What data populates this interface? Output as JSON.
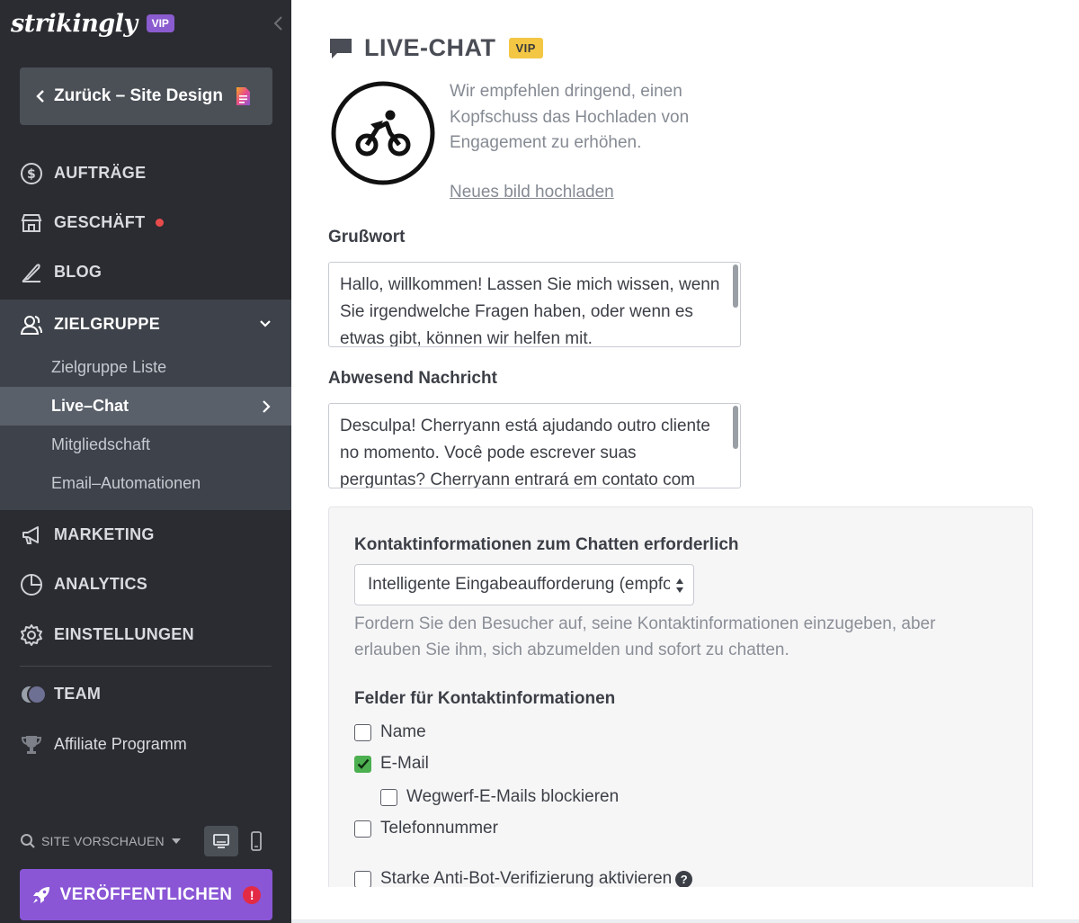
{
  "brand": {
    "logo_text": "strikingly",
    "vip_label": "VIP"
  },
  "sidebar": {
    "back_label": "Zurück – Site Design",
    "nav": [
      {
        "label": "AUFTRÄGE",
        "icon": "dollar-circle-icon"
      },
      {
        "label": "GESCHÄFT",
        "icon": "store-icon",
        "badge": "red-dot"
      },
      {
        "label": "BLOG",
        "icon": "feather-pen-icon"
      },
      {
        "label": "ZIELGRUPPE",
        "icon": "users-icon",
        "expanded": true
      }
    ],
    "audience_sub": [
      {
        "label": "Zielgruppe Liste"
      },
      {
        "label": "Live–Chat",
        "active": true
      },
      {
        "label": "Mitgliedschaft"
      },
      {
        "label": "Email–Automationen"
      }
    ],
    "nav_after": [
      {
        "label": "MARKETING",
        "icon": "megaphone-icon"
      },
      {
        "label": "ANALYTICS",
        "icon": "pie-chart-icon"
      },
      {
        "label": "EINSTELLUNGEN",
        "icon": "gear-icon"
      }
    ],
    "team_label": "TEAM",
    "affiliate_label": "Affiliate Programm",
    "preview_label": "SITE VORSCHAUEN",
    "publish_label": "VERÖFFENTLICHEN",
    "publish_warning": "!"
  },
  "main": {
    "section_title": "LIVE-CHAT",
    "vip_badge": "VIP",
    "avatar_desc": "Wir empfehlen dringend, einen Kopfschuss das Hochladen von Engagement zu erhöhen.",
    "upload_link": "Neues bild hochladen",
    "greeting_label": "Grußwort",
    "greeting_text": "Hallo, willkommen! Lassen Sie mich wissen, wenn Sie irgendwelche Fragen haben, oder wenn es etwas gibt, können wir helfen mit.",
    "away_label": "Abwesend Nachricht",
    "away_text": "Desculpa! Cherryann está ajudando outro cliente no momento. Você pode escrever suas perguntas? Cherryann entrará em contato com",
    "contact_required_heading": "Kontaktinformationen zum Chatten erforderlich",
    "contact_select_value": "Intelligente Eingabeaufforderung (empfohlen)",
    "contact_help": "Fordern Sie den Besucher auf, seine Kontaktinformationen einzugeben, aber erlauben Sie ihm, sich abzumelden und sofort zu chatten.",
    "fields_heading": "Felder für Kontaktinformationen",
    "fields": {
      "name": {
        "label": "Name",
        "checked": false
      },
      "email": {
        "label": "E-Mail",
        "checked": true
      },
      "block_disposable": {
        "label": "Wegwerf-E-Mails blockieren",
        "checked": false
      },
      "phone": {
        "label": "Telefonnummer",
        "checked": false
      },
      "anti_bot": {
        "label": "Starke Anti-Bot-Verifizierung aktivieren",
        "checked": false
      }
    },
    "help_icon_glyph": "?"
  },
  "colors": {
    "sidebar_bg": "#2b2c31",
    "sidebar_group_bg": "#3e424a",
    "sidebar_active_bg": "#5a606a",
    "publish_purple": "#8a56d6",
    "vip_yellow": "#f3c744",
    "checkbox_green": "#4caf50",
    "alert_red": "#e32b45"
  }
}
